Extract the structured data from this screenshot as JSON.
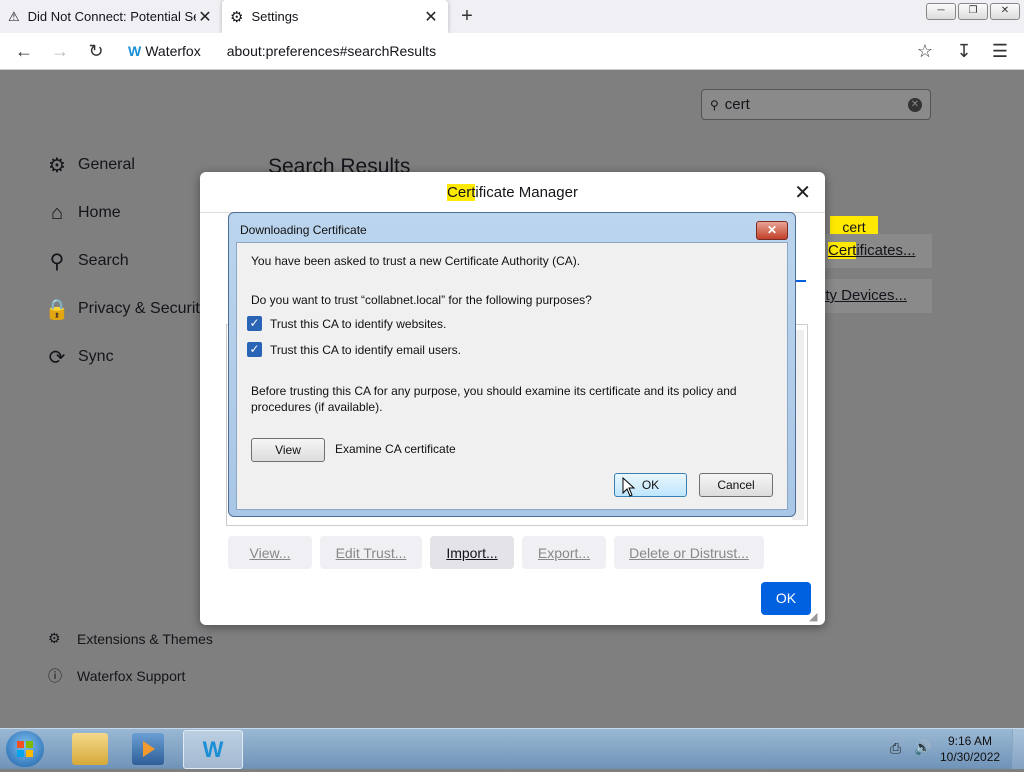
{
  "browser": {
    "tabs": [
      {
        "title": "Did Not Connect: Potential Secu",
        "icon": "warning-icon"
      },
      {
        "title": "Settings",
        "icon": "gear-icon"
      }
    ],
    "brand": "Waterfox",
    "url": "about:preferences#searchResults"
  },
  "settings": {
    "search_value": "cert",
    "search_results_heading": "Search Results",
    "sidebar": [
      {
        "label": "General",
        "icon": "gear-icon"
      },
      {
        "label": "Home",
        "icon": "home-icon"
      },
      {
        "label": "Search",
        "icon": "search-icon"
      },
      {
        "label": "Privacy & Security",
        "icon": "lock-icon"
      },
      {
        "label": "Sync",
        "icon": "sync-icon"
      }
    ],
    "footer_links": [
      {
        "label": "Extensions & Themes",
        "icon": "puzzle-icon"
      },
      {
        "label": "Waterfox Support",
        "icon": "help-icon"
      }
    ],
    "tag_label": "cert",
    "view_certificates_rest": "ificates...",
    "security_devices_label": "rity Devices..."
  },
  "cert_manager": {
    "title_highlight": "Cert",
    "title_rest": "ificate Manager",
    "buttons": [
      "View...",
      "Edit Trust...",
      "Import...",
      "Export...",
      "Delete or Distrust..."
    ],
    "ok_label": "OK"
  },
  "download_dialog": {
    "title": "Downloading Certificate",
    "intro": "You have been asked to trust a new Certificate Authority (CA).",
    "question": "Do you want to trust “collabnet.local” for the following purposes?",
    "checkboxes": [
      {
        "label": "Trust this CA to identify websites.",
        "checked": true
      },
      {
        "label": "Trust this CA to identify email users.",
        "checked": true
      }
    ],
    "advice": "Before trusting this CA for any purpose, you should examine its certificate and its policy and procedures (if available).",
    "view_label": "View",
    "examine_label": "Examine CA certificate",
    "ok_label": "OK",
    "cancel_label": "Cancel"
  },
  "taskbar": {
    "time": "9:16 AM",
    "date": "10/30/2022"
  }
}
